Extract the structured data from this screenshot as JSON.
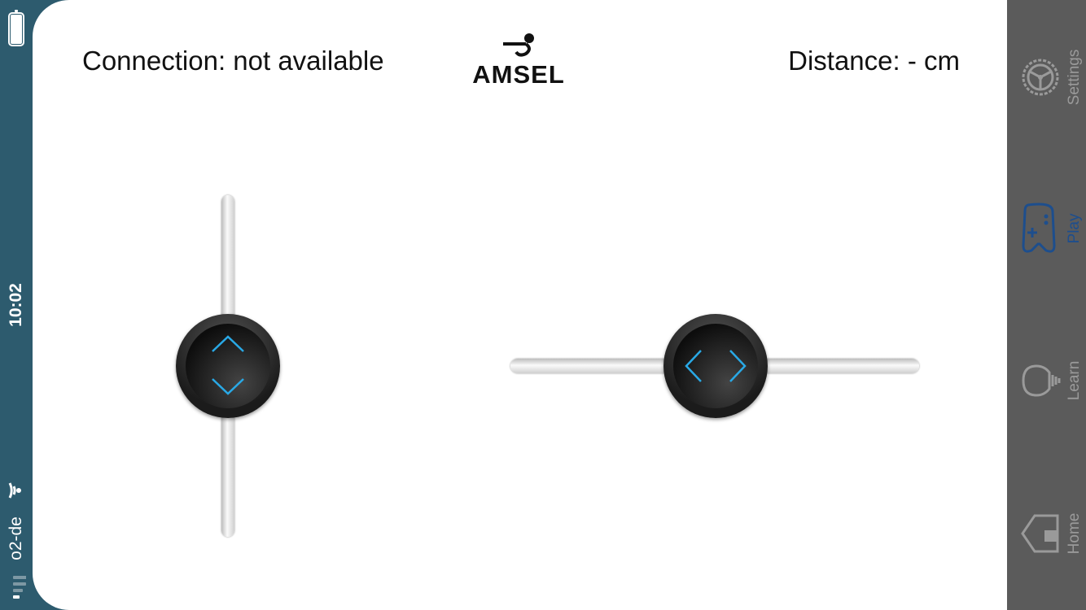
{
  "status_bar": {
    "time": "10:02",
    "carrier": "o2-de"
  },
  "header": {
    "connection_text": "Connection: not available",
    "distance_text": "Distance: - cm",
    "logo_text": "AMSEL"
  },
  "controls": {
    "vertical_slider": {
      "icon": "up-down-chevrons-icon"
    },
    "horizontal_slider": {
      "icon": "left-right-chevrons-icon"
    }
  },
  "tabs": [
    {
      "label": "Settings",
      "icon": "steering-wheel-icon",
      "active": false
    },
    {
      "label": "Play",
      "icon": "gamepad-icon",
      "active": true
    },
    {
      "label": "Learn",
      "icon": "lightbulb-icon",
      "active": false
    },
    {
      "label": "Home",
      "icon": "home-icon",
      "active": false
    }
  ],
  "colors": {
    "status_bar_bg": "#2d5b6e",
    "tab_bar_bg": "#5b5b5b",
    "tab_active": "#1d4e8d",
    "tab_inactive": "#9a9a9a",
    "chevron_accent": "#29a9e6"
  }
}
